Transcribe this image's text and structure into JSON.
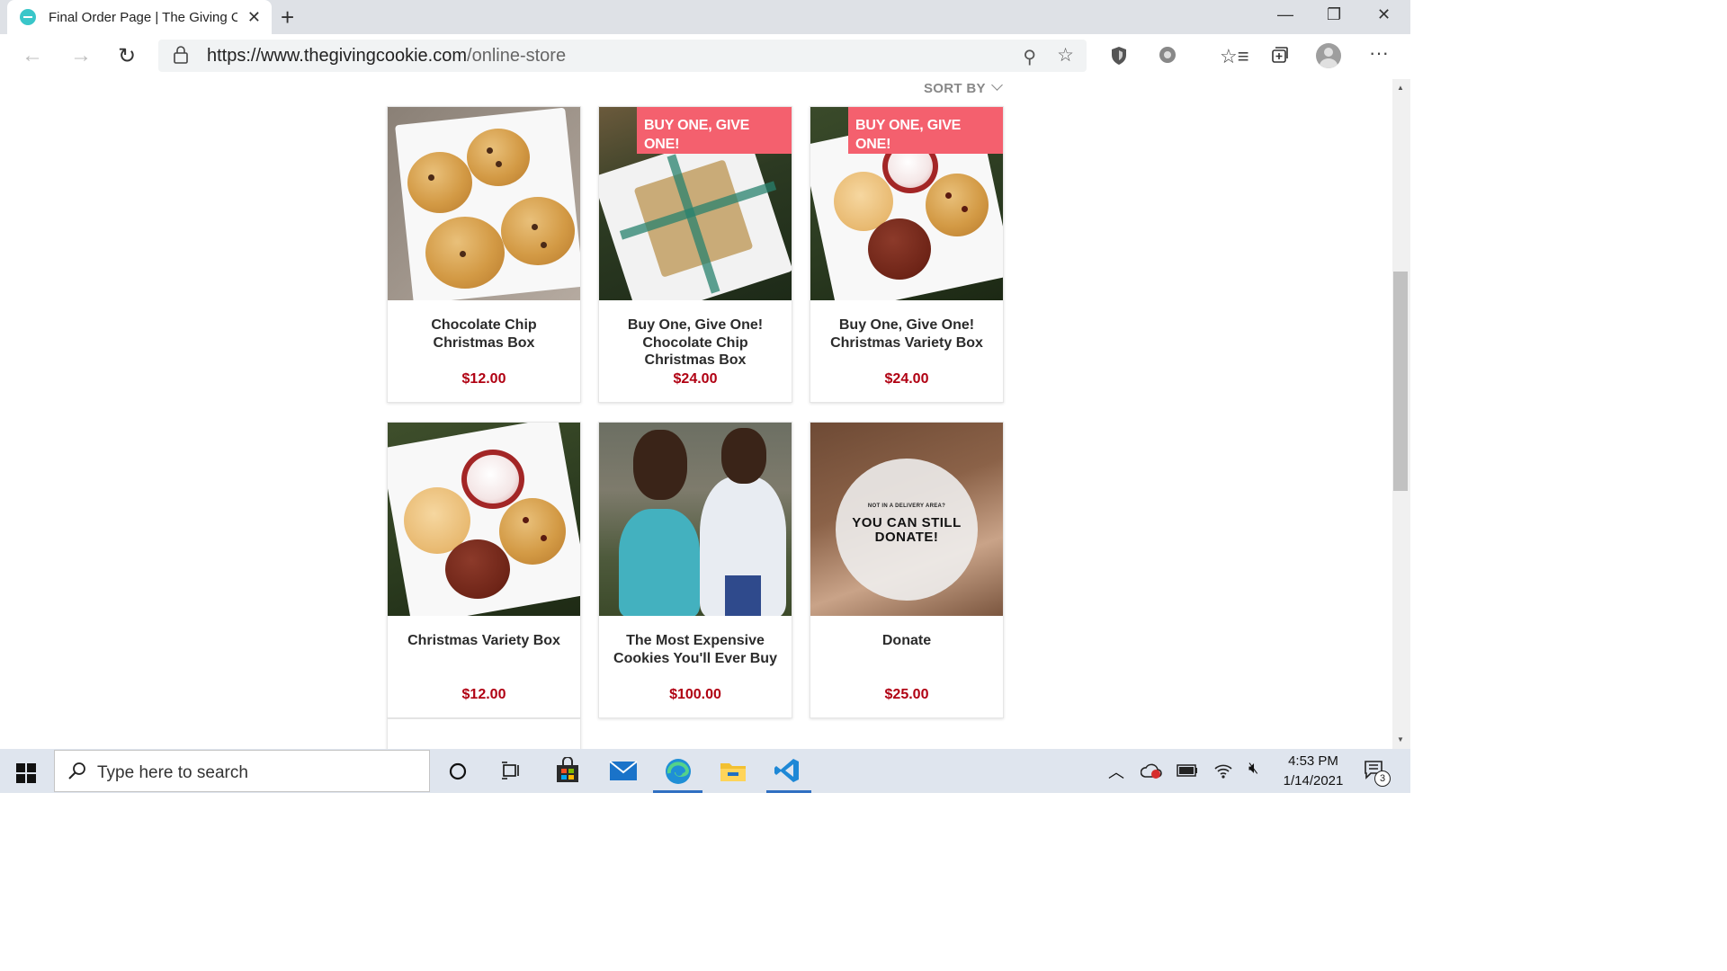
{
  "browser": {
    "tab_title": "Final Order Page | The Giving Co",
    "url_host": "https://www.thegivingcookie.com",
    "url_path": "/online-store"
  },
  "page": {
    "sort_label": "SORT BY",
    "products": [
      {
        "name": "Chocolate Chip Christmas Box",
        "price": "$12.00",
        "badge": null
      },
      {
        "name": "Buy One, Give One! Chocolate Chip Christmas Box",
        "price": "$24.00",
        "badge": "BUY ONE, GIVE ONE!"
      },
      {
        "name": "Buy One, Give One! Christmas Variety Box",
        "price": "$24.00",
        "badge": "BUY ONE, GIVE ONE!"
      },
      {
        "name": "Christmas Variety Box",
        "price": "$12.00",
        "badge": null
      },
      {
        "name": "The Most Expensive Cookies You'll Ever Buy",
        "price": "$100.00",
        "badge": null
      },
      {
        "name": "Donate",
        "price": "$25.00",
        "badge": null,
        "image_text_small": "NOT IN A DELIVERY AREA?",
        "image_text_big": "YOU CAN STILL DONATE!"
      }
    ]
  },
  "taskbar": {
    "search_placeholder": "Type here to search",
    "time": "4:53 PM",
    "date": "1/14/2021",
    "notification_count": "3"
  },
  "colors": {
    "price": "#b00012",
    "badge": "#f4606e",
    "taskbar": "#dfe5ee"
  }
}
